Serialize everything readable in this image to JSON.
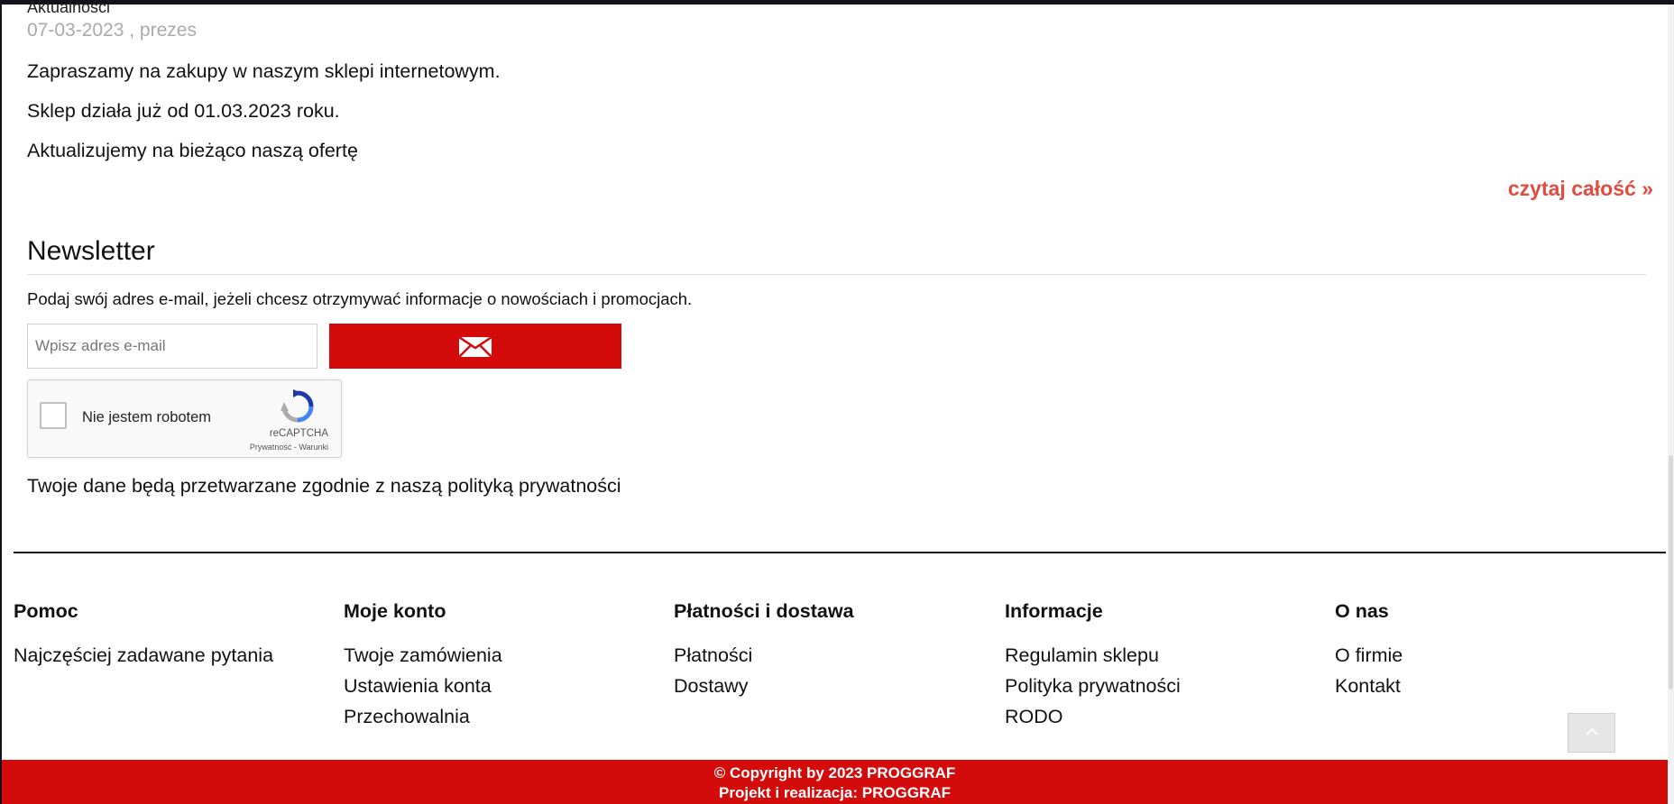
{
  "news": {
    "category": "Aktualności",
    "date_author": "07-03-2023 , prezes",
    "paragraphs": [
      "Zapraszamy na zakupy w naszym sklepi internetowym.",
      "Sklep działa już od 01.03.2023 roku.",
      "Aktualizujemy na bieżąco naszą ofertę"
    ],
    "read_more": "czytaj całość »"
  },
  "newsletter": {
    "title": "Newsletter",
    "description": "Podaj swój adres e-mail, jeżeli chcesz otrzymywać informacje o nowościach i promocjach.",
    "email_placeholder": "Wpisz adres e-mail",
    "submit_icon": "envelope-icon",
    "recaptcha": {
      "label": "Nie jestem robotem",
      "brand": "reCAPTCHA",
      "links": "Prywatność - Warunki"
    },
    "privacy_note": "Twoje dane będą przetwarzane zgodnie z naszą polityką prywatności"
  },
  "footer": {
    "columns": [
      {
        "heading": "Pomoc",
        "links": [
          "Najczęściej zadawane pytania"
        ]
      },
      {
        "heading": "Moje konto",
        "links": [
          "Twoje zamówienia",
          "Ustawienia konta",
          "Przechowalnia"
        ]
      },
      {
        "heading": "Płatności i dostawa",
        "links": [
          "Płatności",
          "Dostawy"
        ]
      },
      {
        "heading": "Informacje",
        "links": [
          "Regulamin sklepu",
          "Polityka prywatności",
          "RODO"
        ]
      },
      {
        "heading": "O nas",
        "links": [
          "O firmie",
          "Kontakt"
        ]
      }
    ],
    "back_to_top_icon": "chevron-up-icon",
    "copyright": "© Copyright by 2023 PROGGRAF",
    "credits": "Projekt i realizacja: PROGGRAF"
  },
  "colors": {
    "brand_red": "#d40b0b",
    "link_red": "#e24b3f",
    "muted_gray": "#aaaaaa"
  }
}
